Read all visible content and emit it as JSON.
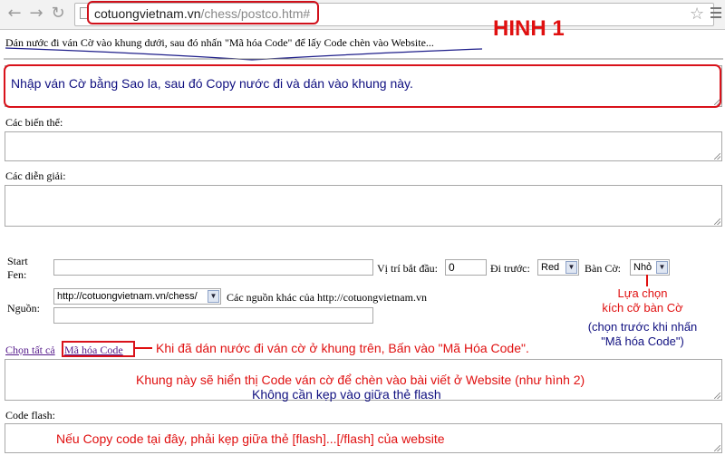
{
  "browser": {
    "url_host": "cotuongvietnam.vn",
    "url_path": "/chess/postco.htm#"
  },
  "page": {
    "instruction": "Dán nước đi ván Cờ vào khung dưới, sau đó nhấn \"Mã hóa Code\" để lấy Code chèn vào Website...",
    "variants_label": "Các biến thể:",
    "commentary_label": "Các diễn giải:",
    "start_fen_label_1": "Start",
    "start_fen_label_2": "Fen:",
    "start_pos_label": "Vị trí bắt đầu:",
    "start_pos_value": "0",
    "first_move_label": "Đi trước:",
    "first_move_value": "Red",
    "board_label": "Bàn Cờ:",
    "board_value": "Nhỏ",
    "source_label": "Nguồn:",
    "source_value": "http://cotuongvietnam.vn/chess/",
    "other_sources_label": "Các nguồn khác của http://cotuongvietnam.vn",
    "select_all_link": "Chọn tất cả",
    "encode_link": "Mã hóa Code",
    "flash_code_label": "Code flash:"
  },
  "annotations": {
    "figure_title": "HINH 1",
    "moves_box_text": "Nhập ván Cờ bằng Sao la, sau đó Copy nước đi và dán vào khung này.",
    "board_size_1": "Lựa chọn",
    "board_size_2": "kích cỡ bàn Cờ",
    "board_size_3": "(chọn trước khi nhấn",
    "board_size_4": "\"Mã hóa Code\")",
    "encode_hint": "Khi đã dán nước đi ván cờ ở khung trên, Bấn vào \"Mã Hóa Code\".",
    "output_red": "Khung này sẽ hiển thị Code ván cờ để chèn vào bài viết ở Website (như hình 2)",
    "output_blue": "Không cần kẹp vào giữa thẻ flash",
    "flash_hint": "Nếu Copy code tại đây, phải kẹp giữa thẻ [flash]...[/flash] của website"
  },
  "colors": {
    "annotation_red": "#e01010",
    "annotation_blue": "#101080"
  }
}
